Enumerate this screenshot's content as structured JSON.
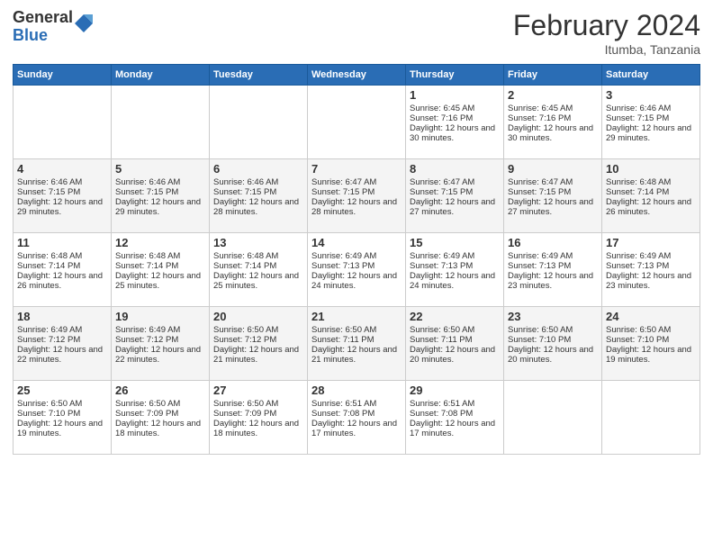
{
  "header": {
    "logo_general": "General",
    "logo_blue": "Blue",
    "title": "February 2024",
    "location": "Itumba, Tanzania"
  },
  "days_of_week": [
    "Sunday",
    "Monday",
    "Tuesday",
    "Wednesday",
    "Thursday",
    "Friday",
    "Saturday"
  ],
  "weeks": [
    [
      {
        "day": "",
        "sunrise": "",
        "sunset": "",
        "daylight": "",
        "empty": true
      },
      {
        "day": "",
        "sunrise": "",
        "sunset": "",
        "daylight": "",
        "empty": true
      },
      {
        "day": "",
        "sunrise": "",
        "sunset": "",
        "daylight": "",
        "empty": true
      },
      {
        "day": "",
        "sunrise": "",
        "sunset": "",
        "daylight": "",
        "empty": true
      },
      {
        "day": "1",
        "sunrise": "Sunrise: 6:45 AM",
        "sunset": "Sunset: 7:16 PM",
        "daylight": "Daylight: 12 hours and 30 minutes.",
        "empty": false
      },
      {
        "day": "2",
        "sunrise": "Sunrise: 6:45 AM",
        "sunset": "Sunset: 7:16 PM",
        "daylight": "Daylight: 12 hours and 30 minutes.",
        "empty": false
      },
      {
        "day": "3",
        "sunrise": "Sunrise: 6:46 AM",
        "sunset": "Sunset: 7:15 PM",
        "daylight": "Daylight: 12 hours and 29 minutes.",
        "empty": false
      }
    ],
    [
      {
        "day": "4",
        "sunrise": "Sunrise: 6:46 AM",
        "sunset": "Sunset: 7:15 PM",
        "daylight": "Daylight: 12 hours and 29 minutes.",
        "empty": false
      },
      {
        "day": "5",
        "sunrise": "Sunrise: 6:46 AM",
        "sunset": "Sunset: 7:15 PM",
        "daylight": "Daylight: 12 hours and 29 minutes.",
        "empty": false
      },
      {
        "day": "6",
        "sunrise": "Sunrise: 6:46 AM",
        "sunset": "Sunset: 7:15 PM",
        "daylight": "Daylight: 12 hours and 28 minutes.",
        "empty": false
      },
      {
        "day": "7",
        "sunrise": "Sunrise: 6:47 AM",
        "sunset": "Sunset: 7:15 PM",
        "daylight": "Daylight: 12 hours and 28 minutes.",
        "empty": false
      },
      {
        "day": "8",
        "sunrise": "Sunrise: 6:47 AM",
        "sunset": "Sunset: 7:15 PM",
        "daylight": "Daylight: 12 hours and 27 minutes.",
        "empty": false
      },
      {
        "day": "9",
        "sunrise": "Sunrise: 6:47 AM",
        "sunset": "Sunset: 7:15 PM",
        "daylight": "Daylight: 12 hours and 27 minutes.",
        "empty": false
      },
      {
        "day": "10",
        "sunrise": "Sunrise: 6:48 AM",
        "sunset": "Sunset: 7:14 PM",
        "daylight": "Daylight: 12 hours and 26 minutes.",
        "empty": false
      }
    ],
    [
      {
        "day": "11",
        "sunrise": "Sunrise: 6:48 AM",
        "sunset": "Sunset: 7:14 PM",
        "daylight": "Daylight: 12 hours and 26 minutes.",
        "empty": false
      },
      {
        "day": "12",
        "sunrise": "Sunrise: 6:48 AM",
        "sunset": "Sunset: 7:14 PM",
        "daylight": "Daylight: 12 hours and 25 minutes.",
        "empty": false
      },
      {
        "day": "13",
        "sunrise": "Sunrise: 6:48 AM",
        "sunset": "Sunset: 7:14 PM",
        "daylight": "Daylight: 12 hours and 25 minutes.",
        "empty": false
      },
      {
        "day": "14",
        "sunrise": "Sunrise: 6:49 AM",
        "sunset": "Sunset: 7:13 PM",
        "daylight": "Daylight: 12 hours and 24 minutes.",
        "empty": false
      },
      {
        "day": "15",
        "sunrise": "Sunrise: 6:49 AM",
        "sunset": "Sunset: 7:13 PM",
        "daylight": "Daylight: 12 hours and 24 minutes.",
        "empty": false
      },
      {
        "day": "16",
        "sunrise": "Sunrise: 6:49 AM",
        "sunset": "Sunset: 7:13 PM",
        "daylight": "Daylight: 12 hours and 23 minutes.",
        "empty": false
      },
      {
        "day": "17",
        "sunrise": "Sunrise: 6:49 AM",
        "sunset": "Sunset: 7:13 PM",
        "daylight": "Daylight: 12 hours and 23 minutes.",
        "empty": false
      }
    ],
    [
      {
        "day": "18",
        "sunrise": "Sunrise: 6:49 AM",
        "sunset": "Sunset: 7:12 PM",
        "daylight": "Daylight: 12 hours and 22 minutes.",
        "empty": false
      },
      {
        "day": "19",
        "sunrise": "Sunrise: 6:49 AM",
        "sunset": "Sunset: 7:12 PM",
        "daylight": "Daylight: 12 hours and 22 minutes.",
        "empty": false
      },
      {
        "day": "20",
        "sunrise": "Sunrise: 6:50 AM",
        "sunset": "Sunset: 7:12 PM",
        "daylight": "Daylight: 12 hours and 21 minutes.",
        "empty": false
      },
      {
        "day": "21",
        "sunrise": "Sunrise: 6:50 AM",
        "sunset": "Sunset: 7:11 PM",
        "daylight": "Daylight: 12 hours and 21 minutes.",
        "empty": false
      },
      {
        "day": "22",
        "sunrise": "Sunrise: 6:50 AM",
        "sunset": "Sunset: 7:11 PM",
        "daylight": "Daylight: 12 hours and 20 minutes.",
        "empty": false
      },
      {
        "day": "23",
        "sunrise": "Sunrise: 6:50 AM",
        "sunset": "Sunset: 7:10 PM",
        "daylight": "Daylight: 12 hours and 20 minutes.",
        "empty": false
      },
      {
        "day": "24",
        "sunrise": "Sunrise: 6:50 AM",
        "sunset": "Sunset: 7:10 PM",
        "daylight": "Daylight: 12 hours and 19 minutes.",
        "empty": false
      }
    ],
    [
      {
        "day": "25",
        "sunrise": "Sunrise: 6:50 AM",
        "sunset": "Sunset: 7:10 PM",
        "daylight": "Daylight: 12 hours and 19 minutes.",
        "empty": false
      },
      {
        "day": "26",
        "sunrise": "Sunrise: 6:50 AM",
        "sunset": "Sunset: 7:09 PM",
        "daylight": "Daylight: 12 hours and 18 minutes.",
        "empty": false
      },
      {
        "day": "27",
        "sunrise": "Sunrise: 6:50 AM",
        "sunset": "Sunset: 7:09 PM",
        "daylight": "Daylight: 12 hours and 18 minutes.",
        "empty": false
      },
      {
        "day": "28",
        "sunrise": "Sunrise: 6:51 AM",
        "sunset": "Sunset: 7:08 PM",
        "daylight": "Daylight: 12 hours and 17 minutes.",
        "empty": false
      },
      {
        "day": "29",
        "sunrise": "Sunrise: 6:51 AM",
        "sunset": "Sunset: 7:08 PM",
        "daylight": "Daylight: 12 hours and 17 minutes.",
        "empty": false
      },
      {
        "day": "",
        "sunrise": "",
        "sunset": "",
        "daylight": "",
        "empty": true
      },
      {
        "day": "",
        "sunrise": "",
        "sunset": "",
        "daylight": "",
        "empty": true
      }
    ]
  ]
}
